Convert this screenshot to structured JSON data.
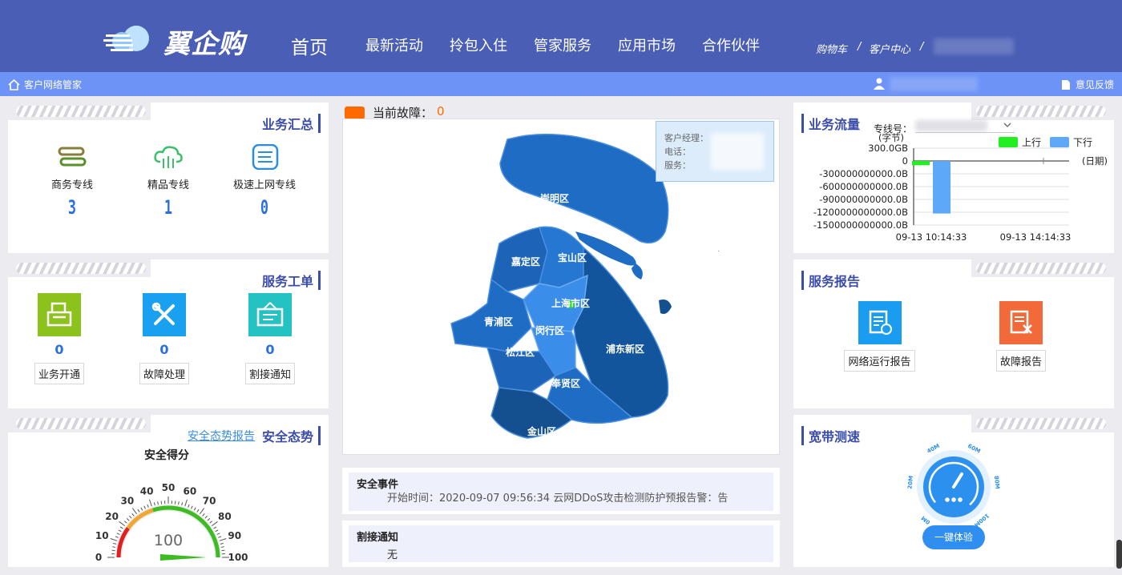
{
  "header": {
    "logo_text": "翼企购",
    "nav": [
      "首页",
      "最新活动",
      "拎包入住",
      "管家服务",
      "应用市场",
      "合作伙伴"
    ],
    "links": {
      "cart": "购物车",
      "sep1": "/",
      "customer_center": "客户中心",
      "sep2": "/"
    }
  },
  "subbar": {
    "left_label": "客户网络管家",
    "right_label": "意见反馈"
  },
  "business_summary": {
    "title": "业务汇总",
    "items": [
      {
        "label": "商务专线",
        "value": "3",
        "icon": "business-line-icon"
      },
      {
        "label": "精品专线",
        "value": "1",
        "icon": "cloud-line-icon"
      },
      {
        "label": "极速上网专线",
        "value": "0",
        "icon": "speed-net-icon"
      }
    ]
  },
  "service_tickets": {
    "title": "服务工单",
    "items": [
      {
        "label": "业务开通",
        "value": "0",
        "color": "#8cc21c",
        "icon": "printer-icon"
      },
      {
        "label": "故障处理",
        "value": "0",
        "color": "#1aa0f0",
        "icon": "tools-icon"
      },
      {
        "label": "割接通知",
        "value": "0",
        "color": "#25c2c4",
        "icon": "notice-board-icon"
      }
    ]
  },
  "security": {
    "title": "安全态势",
    "report_link": "安全态势报告",
    "gauge_title": "安全得分",
    "score": 100,
    "ticks": [
      "0",
      "10",
      "20",
      "30",
      "40",
      "50",
      "60",
      "70",
      "80",
      "90",
      "100"
    ]
  },
  "faults": {
    "label": "当前故障：",
    "count": "0"
  },
  "map": {
    "info": {
      "manager": "客户经理：",
      "phone": "电话：",
      "service": "服务："
    },
    "districts": [
      "崇明区",
      "宝山区",
      "嘉定区",
      "上海市区",
      "青浦区",
      "闵行区",
      "松江区",
      "浦东新区",
      "奉贤区",
      "金山区"
    ]
  },
  "events": {
    "security_title": "安全事件",
    "security_text": "开始时间：2020-09-07 09:56:34 云网DDoS攻击检测防护预报告警：告",
    "cutover_title": "割接通知",
    "cutover_text": "无"
  },
  "traffic": {
    "title": "业务流量",
    "line_label": "专线号：",
    "unit_y": "(字节)",
    "unit_x": "(日期)",
    "legend": [
      {
        "name": "上行",
        "color": "#22ee22"
      },
      {
        "name": "下行",
        "color": "#5ea9f7"
      }
    ]
  },
  "chart_data": {
    "type": "bar",
    "categories": [
      "09-13 10:14:33",
      "09-13 14:14:33"
    ],
    "series": [
      {
        "name": "上行",
        "values": [
          -100000000000,
          0
        ]
      },
      {
        "name": "下行",
        "values": [
          -1230000000000,
          0
        ]
      }
    ],
    "y_ticks": [
      "300.0GB",
      "0",
      "-300000000000.0B",
      "-600000000000.0B",
      "-900000000000.0B",
      "-1200000000000.0B",
      "-1500000000000.0B"
    ],
    "ylim": [
      -1500000000000,
      300000000000
    ],
    "xlabel": "(日期)",
    "ylabel": "(字节)",
    "legend": "top-right"
  },
  "service_report": {
    "title": "服务报告",
    "items": [
      {
        "label": "网络运行报告",
        "color": "#1a9df0",
        "icon": "network-report-icon"
      },
      {
        "label": "故障报告",
        "color": "#f26a3a",
        "icon": "fault-report-icon"
      }
    ]
  },
  "speedtest": {
    "title": "宽带测速",
    "dial_labels": [
      "0M",
      "20M",
      "40M",
      "60M",
      "80M",
      "100M"
    ],
    "button": "一键体验"
  }
}
